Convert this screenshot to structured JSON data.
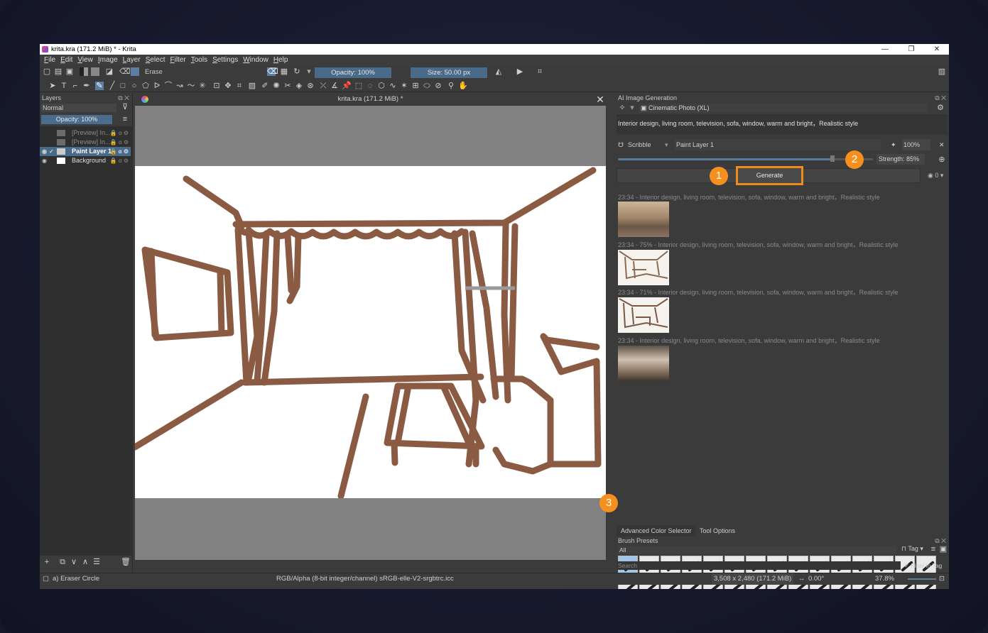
{
  "window": {
    "title": "krita.kra (171.2 MiB) * - Krita",
    "minimize": "—",
    "restore": "❐",
    "close": "✕"
  },
  "menu": [
    "File",
    "Edit",
    "View",
    "Image",
    "Layer",
    "Select",
    "Filter",
    "Tools",
    "Settings",
    "Window",
    "Help"
  ],
  "toolbar": {
    "brush_preset": "Erase",
    "opacity": "Opacity: 100%",
    "size": "Size: 50.00 px"
  },
  "layers_panel": {
    "title": "Layers",
    "blend_mode": "Normal",
    "opacity": "Opacity:  100%",
    "layers": [
      {
        "name": "[Preview] In...",
        "selected": false
      },
      {
        "name": "[Preview] In...",
        "selected": false
      },
      {
        "name": "Paint Layer 1",
        "selected": true
      },
      {
        "name": "Background",
        "selected": false
      }
    ]
  },
  "document": {
    "tab_title": "krita.kra (171.2 MiB) *",
    "stroke_color": "#8b5a43"
  },
  "ai_panel": {
    "title": "AI Image Generation",
    "workflow": "Cinematic Photo (XL)",
    "prompt": "Interior design, living room, television, sofa, window, warm and bright，Realistic style",
    "control_mode": "Scribble",
    "control_layer": "Paint Layer 1",
    "control_strength": "100%",
    "strength": "Strength: 85%",
    "generate_label": "Generate",
    "queue_count": "0",
    "history": [
      {
        "label": "23:34 - Interior design, living room, television, sofa, window, warm and bright，Realistic style",
        "kind": "photo"
      },
      {
        "label": "23:34 - 75% - Interior design, living room, television, sofa, window, warm and bright，Realistic style",
        "kind": "sketch"
      },
      {
        "label": "23:34 - 71% - Interior design, living room, television, sofa, window, warm and bright，Realistic style",
        "kind": "sketch"
      },
      {
        "label": "23:34 - Interior design, living room, television, sofa, window, warm and bright，Realistic style",
        "kind": "photo2"
      }
    ]
  },
  "bottom_tabs": [
    "Advanced Color Selector",
    "Tool Options"
  ],
  "brush_presets": {
    "title": "Brush Presets",
    "filter": "All",
    "tag_label": "Tag",
    "search_placeholder": "Search",
    "filter_in_tag": "Filter in Tag"
  },
  "status": {
    "tool": "a) Eraser Circle",
    "color_space": "RGB/Alpha (8-bit integer/channel)  sRGB-elle-V2-srgbtrc.icc",
    "dimensions": "3,508 x 2,480 (171.2 MiB)",
    "rotation": "0.00°",
    "zoom": "37.8%"
  },
  "badges": [
    "1",
    "2",
    "3"
  ],
  "colors": {
    "accent": "#f5901e",
    "selection": "#4a6a8a",
    "panel": "#3b3b3b"
  }
}
